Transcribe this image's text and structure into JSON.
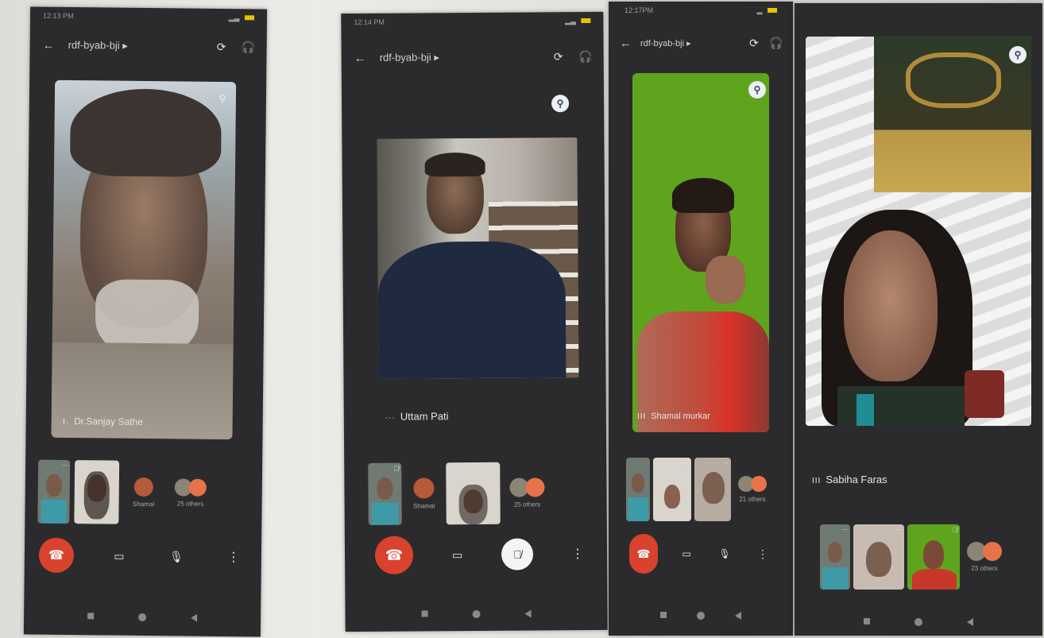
{
  "meeting_code": "rdf-byab-bji",
  "screens": [
    {
      "time": "12:13 PM",
      "title": "rdf-byab-bji ▸",
      "main_name": "Dr.Sanjay Sathe",
      "others_avatar_label": "Shamal",
      "others_count": "25 others"
    },
    {
      "time": "12:14 PM",
      "title": "rdf-byab-bji ▸",
      "main_name": "Uttam Pati",
      "others_avatar_label": "Shamal",
      "others_count": "25 others"
    },
    {
      "time": "12:17PM",
      "title": "rdf-byab-bji ▸",
      "main_name": "Shamal murkar",
      "others_count": "21 others"
    },
    {
      "title": "rdf-byab-bji ▸",
      "main_name": "Sabiha Faras",
      "others_count": "23 others"
    }
  ],
  "icons": {
    "back": "back-arrow-icon",
    "switch_camera": "switch-camera-icon",
    "audio": "headphones-icon",
    "pin": "pin-icon",
    "end_call": "end-call-icon",
    "camera": "video-camera-icon",
    "mic": "microphone-icon",
    "mic_off": "microphone-off-icon",
    "more": "more-vertical-icon"
  },
  "colors": {
    "app_bg": "#2b2b2d",
    "end_call": "#d9422d",
    "pin_bg": "#eef0f6",
    "green_screen": "#5fa41d",
    "avatar_orange": "#e8734a"
  }
}
